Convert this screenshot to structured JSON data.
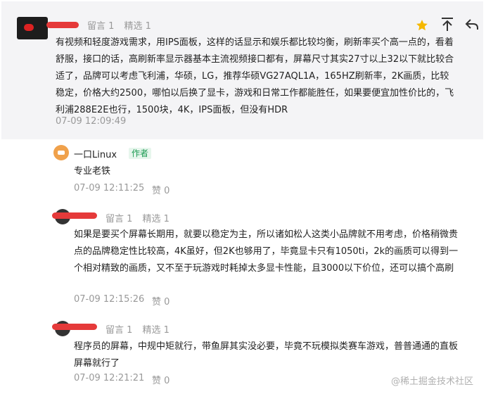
{
  "top": {
    "meta": {
      "comments": "留言 1",
      "featured": "精选 1"
    },
    "text": "有视频和轻度游戏需求，用IPS面板，这样的话显示和娱乐都比较均衡，刷新率买个高一点的，看着舒服，接口的话，高刷新率显示器基本主流视频接口都有，屏幕尺寸其实27寸以上32以下就比较合适了，品牌可以考虑飞利浦，华硕，LG，推荐华硕VG27AQL1A，165HZ刷新率，2K画质，比较稳定，价格大约2500，哪怕以后换了显卡，游戏和日常工作都能胜任，如果要便宜加性价比的，飞利浦288E2E也行，1500块，4K，IPS面板，但没有HDR",
    "time": "07-09 12:09:49"
  },
  "reply": {
    "name": "一口Linux",
    "badge": "作者",
    "text": "专业老铁",
    "time": "07-09 12:11:25",
    "like": "赞 0"
  },
  "comment2": {
    "meta": {
      "comments": "留言 1",
      "featured": "精选 1"
    },
    "text": "如果是要买个屏幕长期用，就要以稳定为主，所以诸如松人这类小品牌就不用考虑，价格稍微贵点的品牌稳定性比较高，4K虽好，但2K也够用了，毕竟显卡只有1050ti，2k的画质可以得到一个相对精致的画质，又不至于玩游戏时耗掉太多显卡性能，且3000以下价位，还可以搞个高刷",
    "time": "07-09 12:15:26",
    "like": "赞 0"
  },
  "comment3": {
    "meta": {
      "comments": "留言 1",
      "featured": "精选 1"
    },
    "text": "程序员的屏幕，中规中矩就行，带鱼屏其实没必要，毕竟不玩模拟类赛车游戏，普普通通的直板屏幕就行了",
    "time": "07-09 12:21:21",
    "like": "赞 0"
  },
  "credit": "@稀土掘金技术社区",
  "colors": {
    "star": "#f5b800",
    "accent": "#1b9a52"
  }
}
